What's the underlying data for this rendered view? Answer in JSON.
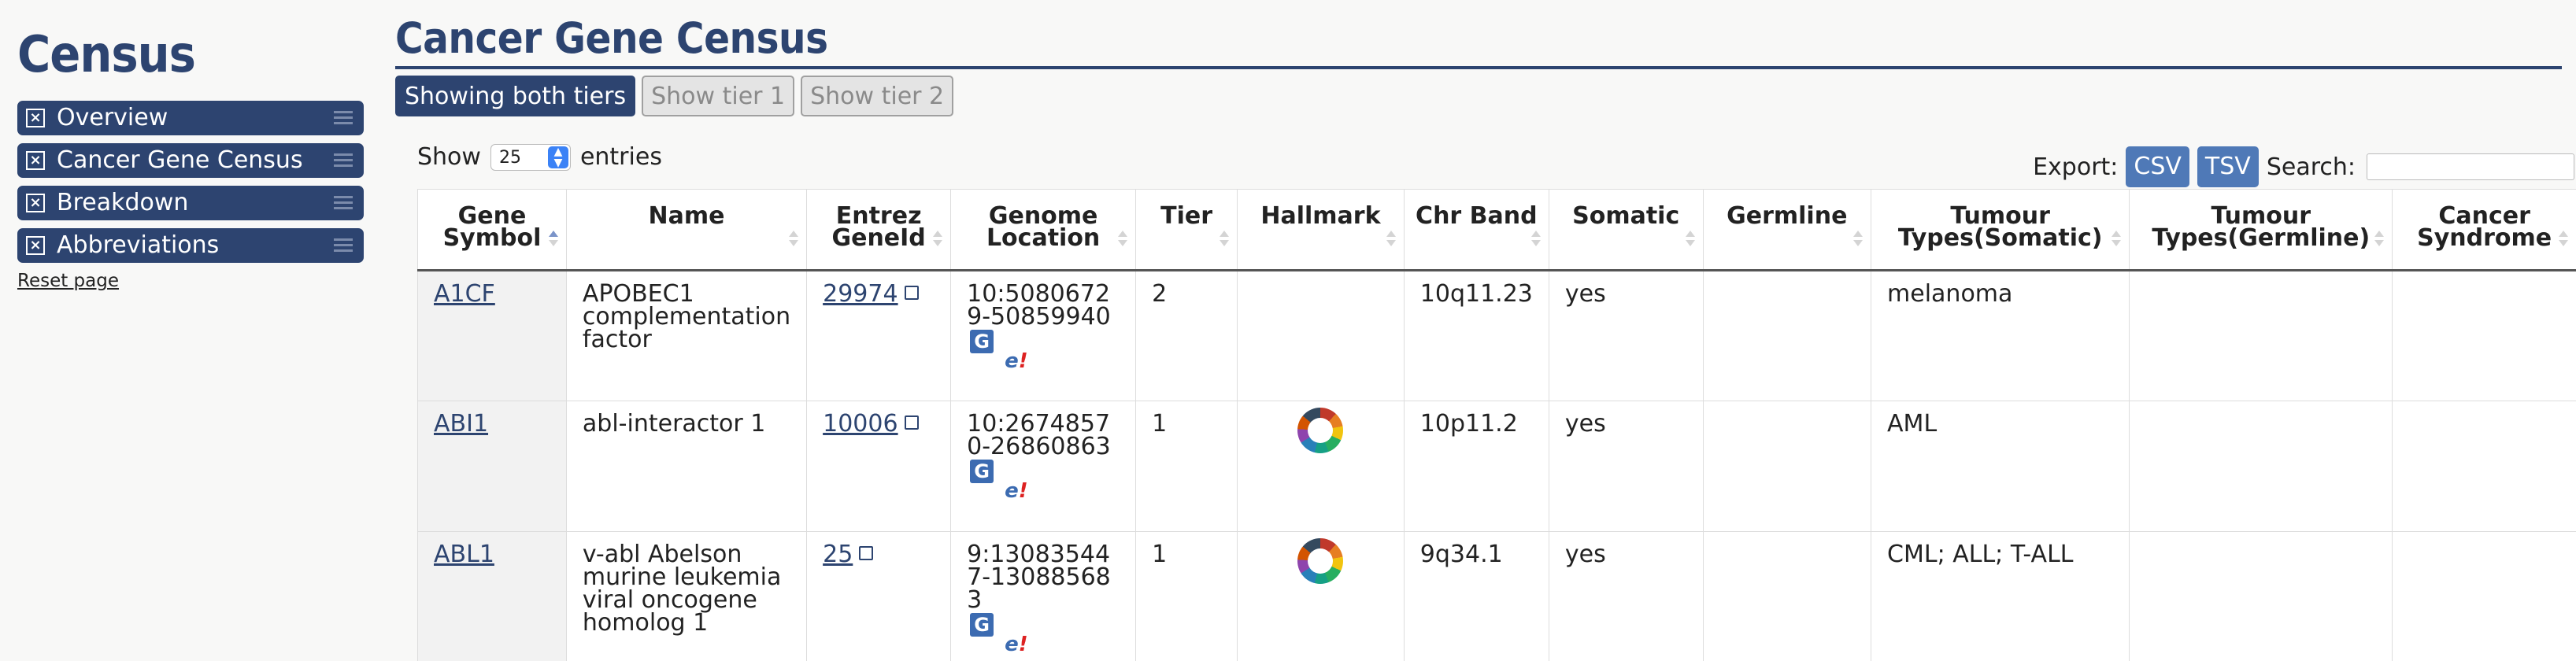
{
  "sidebar": {
    "title": "Census",
    "items": [
      {
        "label": "Overview"
      },
      {
        "label": "Cancer Gene Census"
      },
      {
        "label": "Breakdown"
      },
      {
        "label": "Abbreviations"
      }
    ],
    "reset": "Reset page"
  },
  "page": {
    "title": "Cancer Gene Census",
    "tiers": {
      "both": "Showing both tiers",
      "tier1": "Show tier 1",
      "tier2": "Show tier 2"
    }
  },
  "controls": {
    "show": "Show",
    "entries_value": "25",
    "entries": "entries",
    "export": "Export:",
    "csv": "CSV",
    "tsv": "TSV",
    "search": "Search:"
  },
  "table": {
    "headers": [
      "Gene Symbol",
      "Name",
      "Entrez GeneId",
      "Genome Location",
      "Tier",
      "Hallmark",
      "Chr Band",
      "Somatic",
      "Germline",
      "Tumour Types(Somatic)",
      "Tumour Types(Germline)",
      "Cancer Syndrome"
    ],
    "rows": [
      {
        "symbol": "A1CF",
        "name": "APOBEC1 complementation factor",
        "entrez": "29974",
        "location": "10:50806729-50859940",
        "tier": "2",
        "hallmark": false,
        "chr": "10q11.23",
        "somatic": "yes",
        "germline": "",
        "tumour_somatic": "melanoma",
        "tumour_germline": "",
        "syndrome": ""
      },
      {
        "symbol": "ABI1",
        "name": "abl-interactor 1",
        "entrez": "10006",
        "location": "10:26748570-26860863",
        "tier": "1",
        "hallmark": true,
        "chr": "10p11.2",
        "somatic": "yes",
        "germline": "",
        "tumour_somatic": "AML",
        "tumour_germline": "",
        "syndrome": ""
      },
      {
        "symbol": "ABL1",
        "name": "v-abl Abelson murine leukemia viral oncogene homolog 1",
        "entrez": "25",
        "location": "9:130835447-130885683",
        "tier": "1",
        "hallmark": true,
        "chr": "9q34.1",
        "somatic": "yes",
        "germline": "",
        "tumour_somatic": "CML; ALL; T-ALL",
        "tumour_germline": "",
        "syndrome": ""
      }
    ]
  },
  "icons": {
    "genome_browser": "G",
    "ensembl": "e!"
  },
  "colors": {
    "brand": "#2d4470",
    "export_btn": "#4f79b7"
  }
}
